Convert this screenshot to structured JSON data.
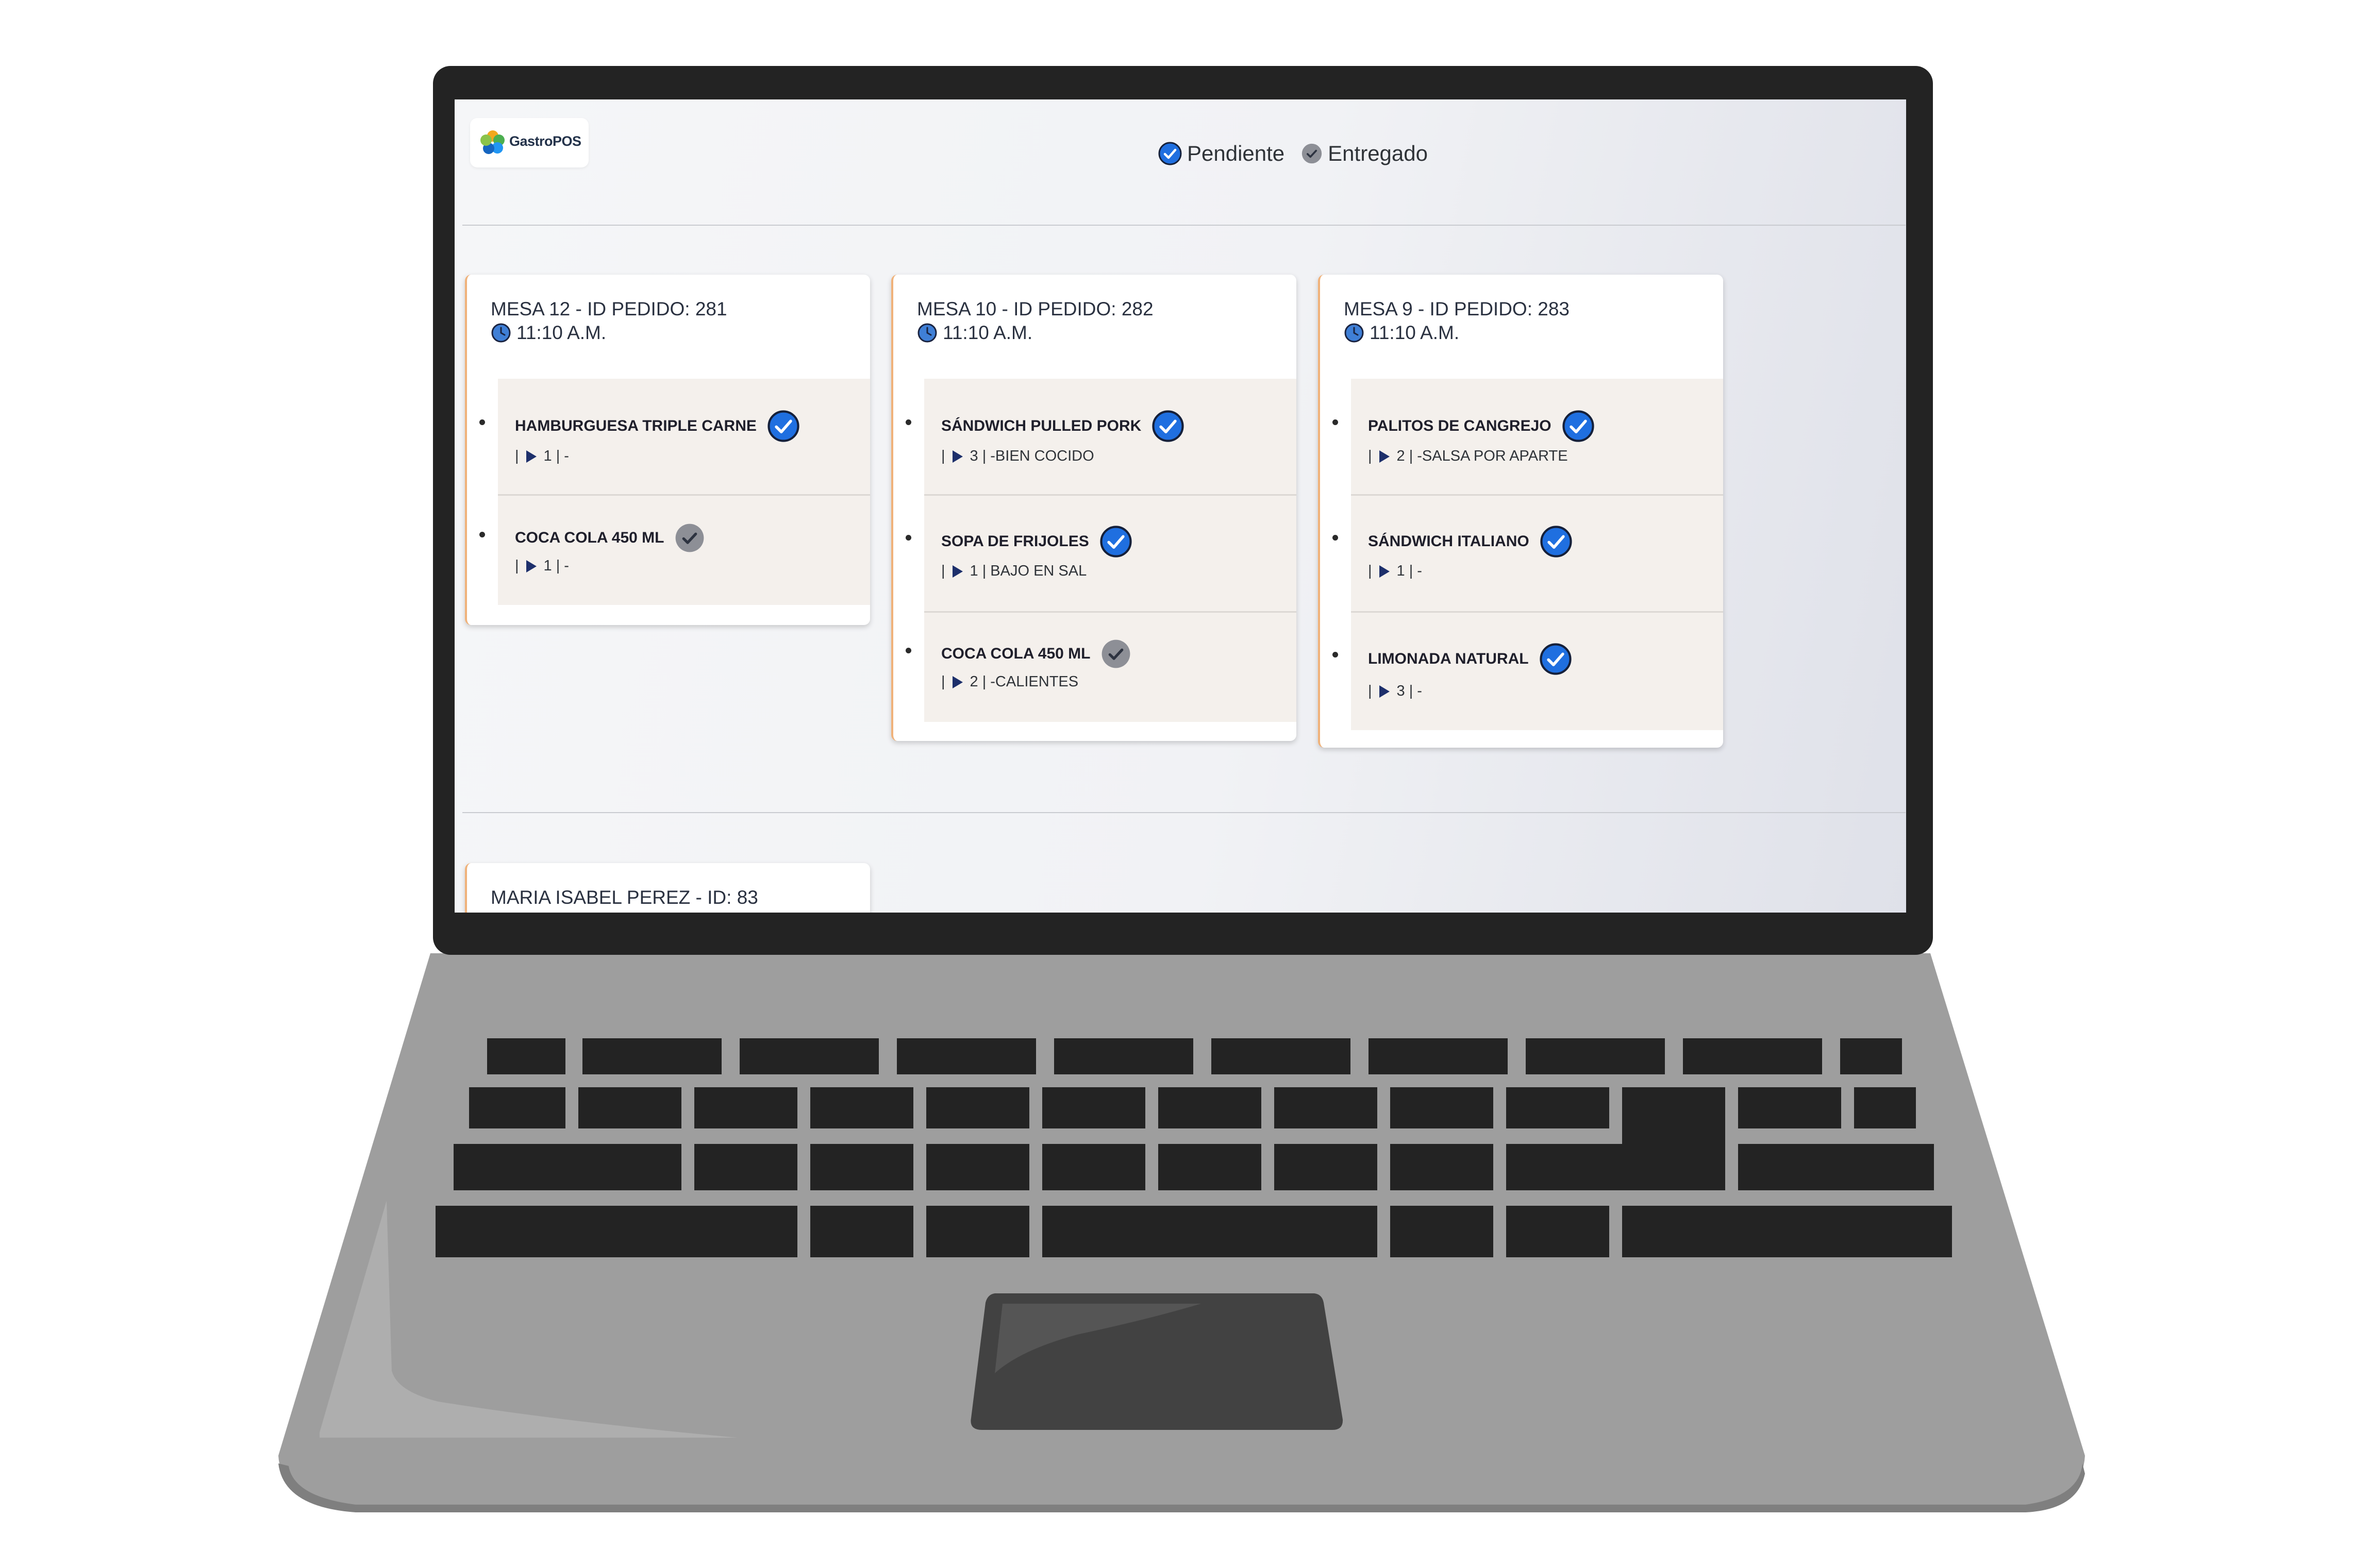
{
  "app": {
    "brand": "GastroPOS"
  },
  "legend": {
    "pending": "Pendiente",
    "delivered": "Entregado"
  },
  "colors": {
    "pending_icon": "#1f6fe0",
    "delivered_icon": "#8d8f96",
    "card_accent": "#f0b27a",
    "play_icon": "#1d2f6b"
  },
  "orders": [
    {
      "title": "MESA 12 - ID PEDIDO: 281",
      "time": "11:10 A.M.",
      "items": [
        {
          "name": "HAMBURGUESA TRIPLE CARNE",
          "status": "pending",
          "meta_pre": "|",
          "qty": "1",
          "meta_post": "| -"
        },
        {
          "name": "COCA COLA 450 ML",
          "status": "delivered",
          "meta_pre": "|",
          "qty": "1",
          "meta_post": "| -"
        }
      ]
    },
    {
      "title": "MESA 10 - ID PEDIDO: 282",
      "time": "11:10 A.M.",
      "items": [
        {
          "name": "SÁNDWICH PULLED PORK",
          "status": "pending",
          "meta_pre": "|",
          "qty": "3",
          "meta_post": "| -BIEN COCIDO"
        },
        {
          "name": "SOPA DE FRIJOLES",
          "status": "pending",
          "meta_pre": "|",
          "qty": "1",
          "meta_post": "| BAJO EN SAL"
        },
        {
          "name": "COCA COLA 450 ML",
          "status": "delivered",
          "meta_pre": "|",
          "qty": "2",
          "meta_post": "| -CALIENTES"
        }
      ]
    },
    {
      "title": "MESA 9 - ID PEDIDO: 283",
      "time": "11:10 A.M.",
      "items": [
        {
          "name": "PALITOS DE CANGREJO",
          "status": "pending",
          "meta_pre": "|",
          "qty": "2",
          "meta_post": "| -SALSA POR APARTE"
        },
        {
          "name": "SÁNDWICH ITALIANO",
          "status": "pending",
          "meta_pre": "|",
          "qty": "1",
          "meta_post": "| -"
        },
        {
          "name": "LIMONADA NATURAL",
          "status": "pending",
          "meta_pre": "|",
          "qty": "3",
          "meta_post": "| -"
        }
      ]
    }
  ],
  "second_section": {
    "card_title": "MARIA ISABEL PEREZ - ID: 83"
  }
}
